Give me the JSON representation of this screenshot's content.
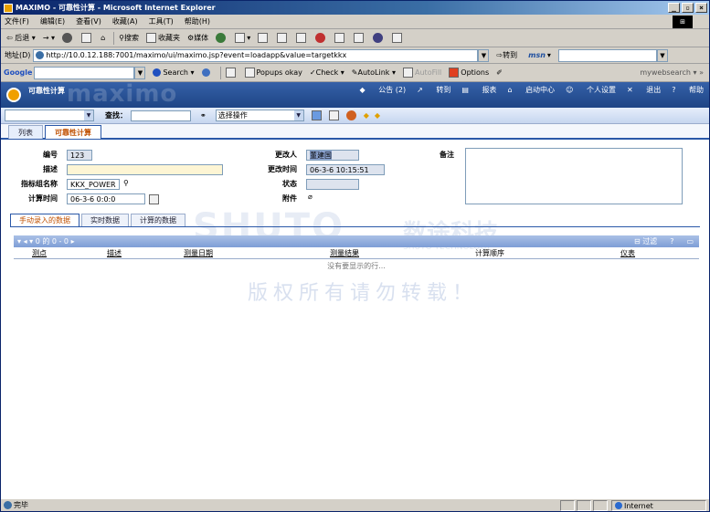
{
  "window": {
    "title": "MAXIMO - 可靠性计算 - Microsoft Internet Explorer"
  },
  "menu": [
    "文件(F)",
    "编辑(E)",
    "查看(V)",
    "收藏(A)",
    "工具(T)",
    "帮助(H)"
  ],
  "toolbar": {
    "back": "后退",
    "search": "搜索",
    "favorites": "收藏夹",
    "media": "媒体"
  },
  "address": {
    "label": "地址(D)",
    "url": "http://10.0.12.188:7001/maximo/ui/maximo.jsp?event=loadapp&value=targetkkx",
    "go": "转到",
    "msn": "msn"
  },
  "googlebar": {
    "logo": "Google",
    "search": "Search",
    "popups": "Popups okay",
    "check": "Check",
    "autolink": "AutoLink",
    "autofill": "AutoFill",
    "options": "Options",
    "mywebsearch": "mywebsearch"
  },
  "app": {
    "header_title": "可靠性计算",
    "brand_watermark": "maximo",
    "nav": [
      "公告 (2)",
      "转到",
      "报表",
      "启动中心",
      "个人设置",
      "退出",
      "帮助"
    ]
  },
  "app_toolbar": {
    "find_label": "查找：",
    "action_select": "选择操作"
  },
  "main_tabs": [
    "列表",
    "可靠性计算"
  ],
  "form": {
    "id_label": "编号",
    "id_value": "123",
    "desc_label": "描述",
    "desc_value": "",
    "group_label": "指标组名称",
    "group_value": "KKX_POWER",
    "calctime_label": "计算时间",
    "calctime_value": "06-3-6 0:0:0",
    "changedby_label": "更改人",
    "changedby_value": "董建国",
    "changedate_label": "更改时间",
    "changedate_value": "06-3-6 10:15:51",
    "status_label": "状态",
    "status_value": "",
    "attach_label": "附件",
    "memo_label": "备注"
  },
  "sub_tabs": [
    "手动录入的数据",
    "实时数据",
    "计算的数据"
  ],
  "table": {
    "pager": "0 的 0 - 0",
    "filter_label": "过滤",
    "columns": [
      "测点",
      "描述",
      "测量日期",
      "测量结果",
      "计算顺序",
      "仪表"
    ],
    "empty_text": "没有要显示的行..."
  },
  "watermark": {
    "logo": "SHUTO",
    "cn_name": "数途科技",
    "en_name": "SHUTO TECHNOLOGY",
    "notice": "版权所有请勿转载！"
  },
  "status": {
    "text": "完毕",
    "zone": "Internet"
  }
}
